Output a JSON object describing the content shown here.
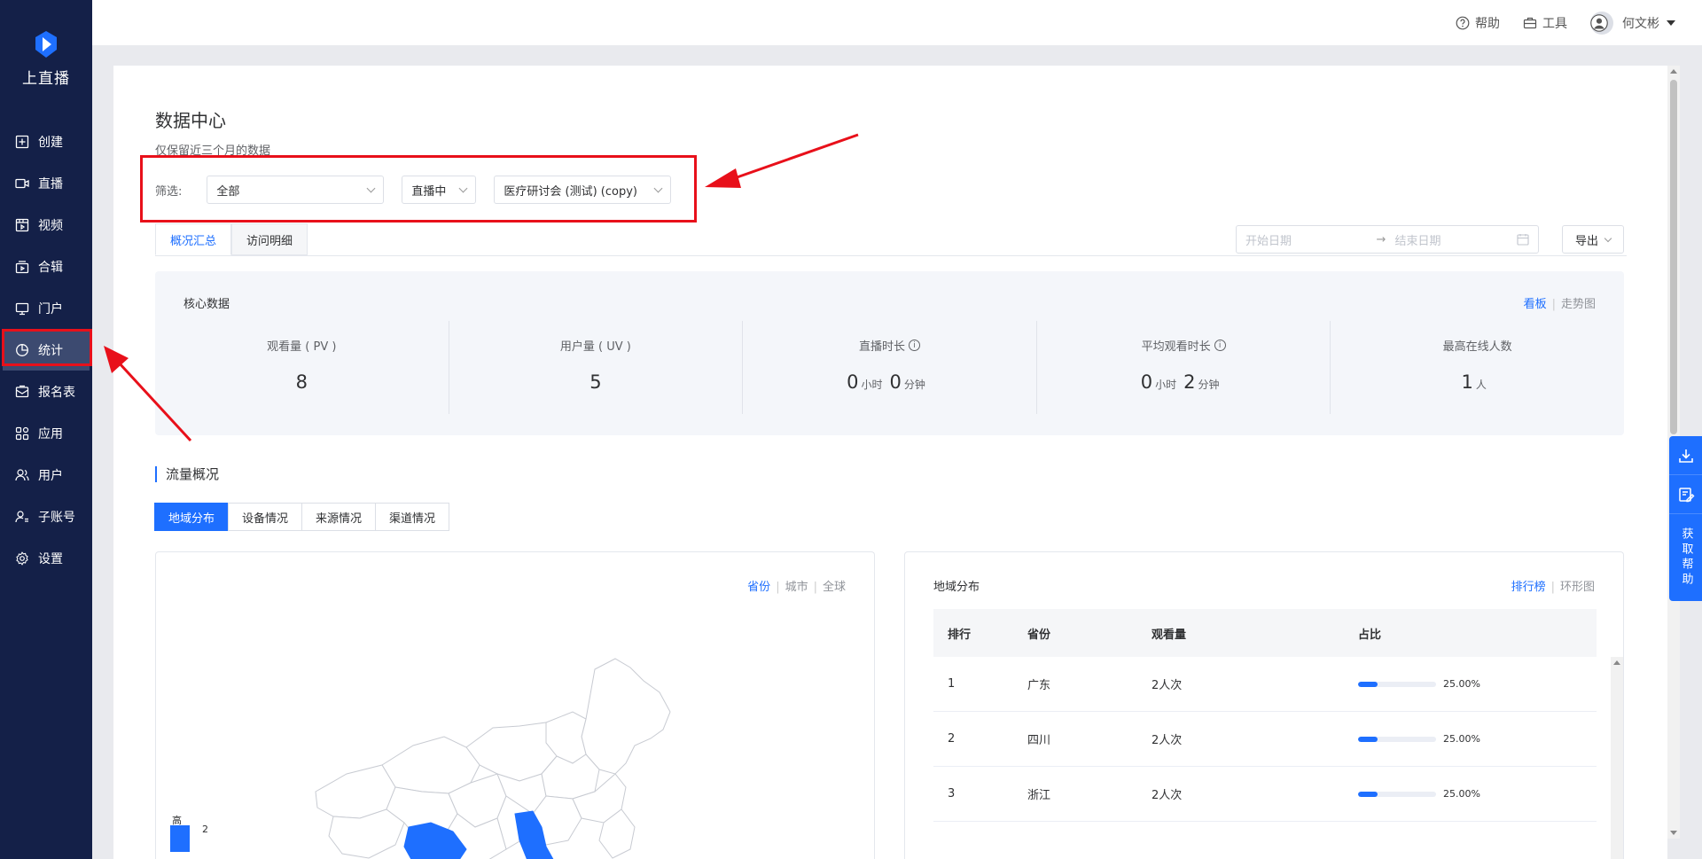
{
  "app": {
    "name": "上直播"
  },
  "sidebar": {
    "items": [
      {
        "label": "创建",
        "icon": "plus-square-icon"
      },
      {
        "label": "直播",
        "icon": "video-camera-icon"
      },
      {
        "label": "视频",
        "icon": "film-icon"
      },
      {
        "label": "合辑",
        "icon": "collection-icon"
      },
      {
        "label": "门户",
        "icon": "monitor-icon"
      },
      {
        "label": "统计",
        "icon": "pie-chart-icon",
        "active": true
      },
      {
        "label": "报名表",
        "icon": "mail-form-icon"
      },
      {
        "label": "应用",
        "icon": "apps-grid-icon"
      },
      {
        "label": "用户",
        "icon": "users-icon"
      },
      {
        "label": "子账号",
        "icon": "sub-account-icon"
      },
      {
        "label": "设置",
        "icon": "gear-icon"
      }
    ]
  },
  "topbar": {
    "help": "帮助",
    "tools": "工具",
    "username": "何文彬"
  },
  "page": {
    "title": "数据中心",
    "subtitle": "仅保留近三个月的数据"
  },
  "filters": {
    "label": "筛选:",
    "type": "全部",
    "status": "直播中",
    "event": "医疗研讨会 (测试) (copy)"
  },
  "tabs": [
    {
      "label": "概况汇总",
      "active": true
    },
    {
      "label": "访问明细",
      "active": false
    }
  ],
  "date_range": {
    "start_placeholder": "开始日期",
    "end_placeholder": "结束日期"
  },
  "export_label": "导出",
  "core": {
    "title": "核心数据",
    "view_board": "看板",
    "view_trend": "走势图",
    "stats": {
      "pv": {
        "label": "观看量 ( PV )",
        "value": "8"
      },
      "uv": {
        "label": "用户量 ( UV )",
        "value": "5"
      },
      "live_duration": {
        "label": "直播时长",
        "hours": "0",
        "hours_unit": "小时",
        "minutes": "0",
        "minutes_unit": "分钟"
      },
      "avg_watch": {
        "label": "平均观看时长",
        "hours": "0",
        "hours_unit": "小时",
        "minutes": "2",
        "minutes_unit": "分钟"
      },
      "peak_online": {
        "label": "最高在线人数",
        "value": "1",
        "unit": "人"
      }
    }
  },
  "flow": {
    "title": "流量概况",
    "segments": [
      "地域分布",
      "设备情况",
      "来源情况",
      "渠道情况"
    ]
  },
  "map": {
    "switch": {
      "province": "省份",
      "city": "城市",
      "global": "全球"
    },
    "legend_high": "高",
    "legend_value": "2"
  },
  "ranking": {
    "title": "地域分布",
    "view_rank": "排行榜",
    "view_ring": "环形图",
    "headers": [
      "排行",
      "省份",
      "观看量",
      "占比"
    ],
    "rows": [
      {
        "rank": "1",
        "province": "广东",
        "views": "2人次",
        "percent": "25.00%",
        "fraction": 0.25
      },
      {
        "rank": "2",
        "province": "四川",
        "views": "2人次",
        "percent": "25.00%",
        "fraction": 0.25
      },
      {
        "rank": "3",
        "province": "浙江",
        "views": "2人次",
        "percent": "25.00%",
        "fraction": 0.25
      }
    ]
  },
  "float": {
    "help_label": "获取帮助"
  },
  "colors": {
    "sidebar_bg": "#142048",
    "accent": "#1e6fff",
    "annotation_red": "#e8101a"
  }
}
